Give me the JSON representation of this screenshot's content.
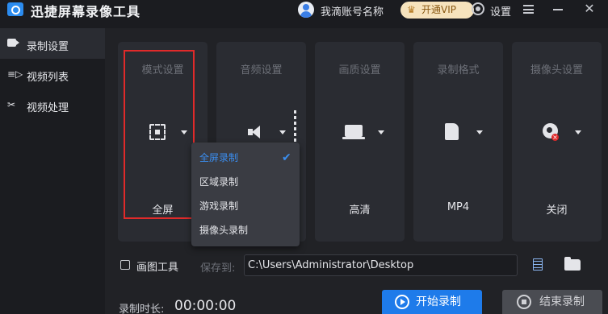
{
  "app": {
    "title": "迅捷屏幕录像工具"
  },
  "header": {
    "account_name": "我滴账号名称",
    "vip_label": "开通VIP",
    "settings_label": "设置",
    "accent_color": "#1e7bea",
    "vip_color": "#f6e3bd"
  },
  "sidebar": {
    "items": [
      {
        "label": "录制设置",
        "icon": "video-camera-icon",
        "active": true
      },
      {
        "label": "视频列表",
        "icon": "list-play-icon",
        "active": false
      },
      {
        "label": "视频处理",
        "icon": "tools-icon",
        "active": false
      }
    ]
  },
  "cards": [
    {
      "title": "模式设置",
      "value": "全屏",
      "icon": "fullscreen-icon"
    },
    {
      "title": "音频设置",
      "value": "",
      "icon": "speaker-icon"
    },
    {
      "title": "画质设置",
      "value": "高清",
      "icon": "monitor-icon"
    },
    {
      "title": "录制格式",
      "value": "MP4",
      "icon": "file-icon"
    },
    {
      "title": "摄像头设置",
      "value": "关闭",
      "icon": "webcam-off-icon"
    }
  ],
  "mode_dropdown": {
    "options": [
      "全屏录制",
      "区域录制",
      "游戏录制",
      "摄像头录制"
    ],
    "selected": "全屏录制"
  },
  "bottom": {
    "draw_tool_label": "画图工具",
    "draw_tool_checked": false,
    "save_to_label": "保存到:",
    "save_path": "C:\\Users\\Administrator\\Desktop",
    "duration_label": "录制时长:",
    "duration_value": "00:00:00",
    "start_label": "开始录制",
    "stop_label": "结束录制"
  }
}
